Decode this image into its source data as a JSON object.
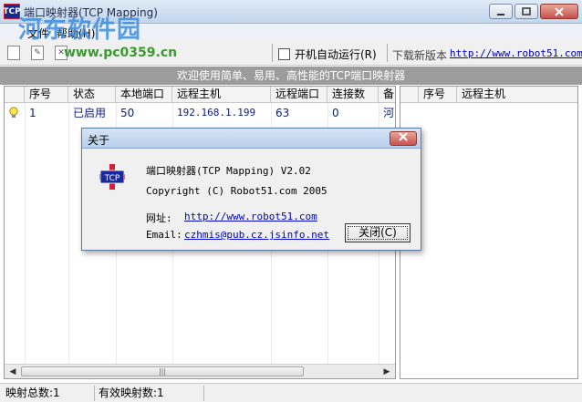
{
  "window": {
    "title": "端口映射器(TCP Mapping)",
    "app_icon_text": "TCP"
  },
  "menu": [
    "文件",
    "帮助(H)"
  ],
  "watermark": {
    "text": "河东软件园",
    "url": "www.pc0359.cn"
  },
  "toolbar": {
    "autostart_label": "开机自动运行(R)",
    "download_label": "下载新版本",
    "download_link": "http://www.robot51.com"
  },
  "banner": "欢迎使用简单、易用、高性能的TCP端口映射器",
  "left_table": {
    "columns": [
      "序号",
      "状态",
      "本地端口",
      "远程主机",
      "远程端口",
      "连接数",
      "备"
    ],
    "rows": [
      {
        "index": "1",
        "status": "已启用",
        "local_port": "50",
        "remote_host": "192.168.1.199",
        "remote_port": "63",
        "connections": "0",
        "note": "河"
      }
    ]
  },
  "right_table": {
    "columns": [
      "序号",
      "远程主机"
    ]
  },
  "statusbar": {
    "total": "映射总数:1",
    "active": "有效映射数:1"
  },
  "about": {
    "title": "关于",
    "product": "端口映射器(TCP Mapping) V2.02",
    "copyright": "Copyright (C) Robot51.com  2005",
    "website_label": "网址:",
    "website": "http://www.robot51.com",
    "email_label": "Email:",
    "email": "czhmis@pub.cz.jsinfo.net",
    "close_button": "关闭(C)",
    "logo_text": "TCP"
  },
  "colors": {
    "banner_bg": "#9c9c9c",
    "link": "#0000cc",
    "row_text": "#0c1a8c"
  }
}
